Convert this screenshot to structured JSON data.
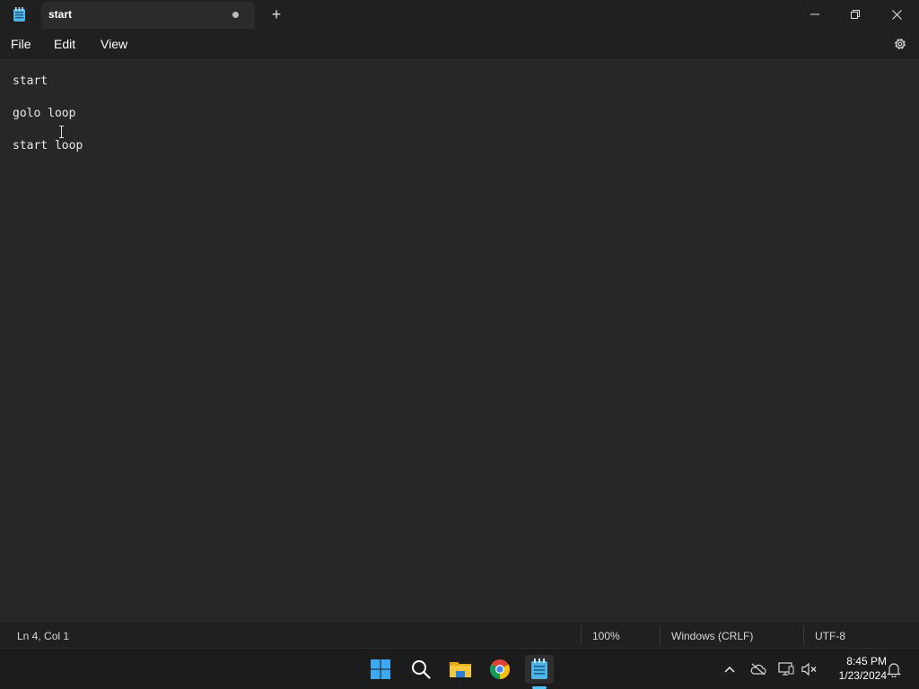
{
  "window": {
    "app_icon": "notepad-icon",
    "tab_title": "start",
    "unsaved_indicator": "unsaved-dot-icon",
    "new_tab_icon": "plus-icon",
    "controls": [
      "minimize-icon",
      "restore-icon",
      "close-icon"
    ]
  },
  "menu": {
    "items": [
      "File",
      "Edit",
      "View"
    ],
    "settings_icon": "gear-icon"
  },
  "editor": {
    "lines": [
      "start",
      "",
      "golo loop",
      "",
      "start loop"
    ]
  },
  "status": {
    "position": "Ln 4, Col 1",
    "zoom": "100%",
    "line_ending": "Windows (CRLF)",
    "encoding": "UTF-8"
  },
  "taskbar": {
    "apps": [
      "windows-start-icon",
      "search-icon",
      "file-explorer-icon",
      "chrome-icon",
      "notepad-icon"
    ],
    "tray": [
      "chevron-up-icon",
      "onedrive-offline-icon",
      "network-icon",
      "volume-muted-icon",
      "notification-bell-icon"
    ],
    "time": "8:45 PM",
    "date": "1/23/2024"
  },
  "colors": {
    "accent": "#4cc2ff",
    "editor_bg": "#272727",
    "chrome_bg": "#202020"
  }
}
